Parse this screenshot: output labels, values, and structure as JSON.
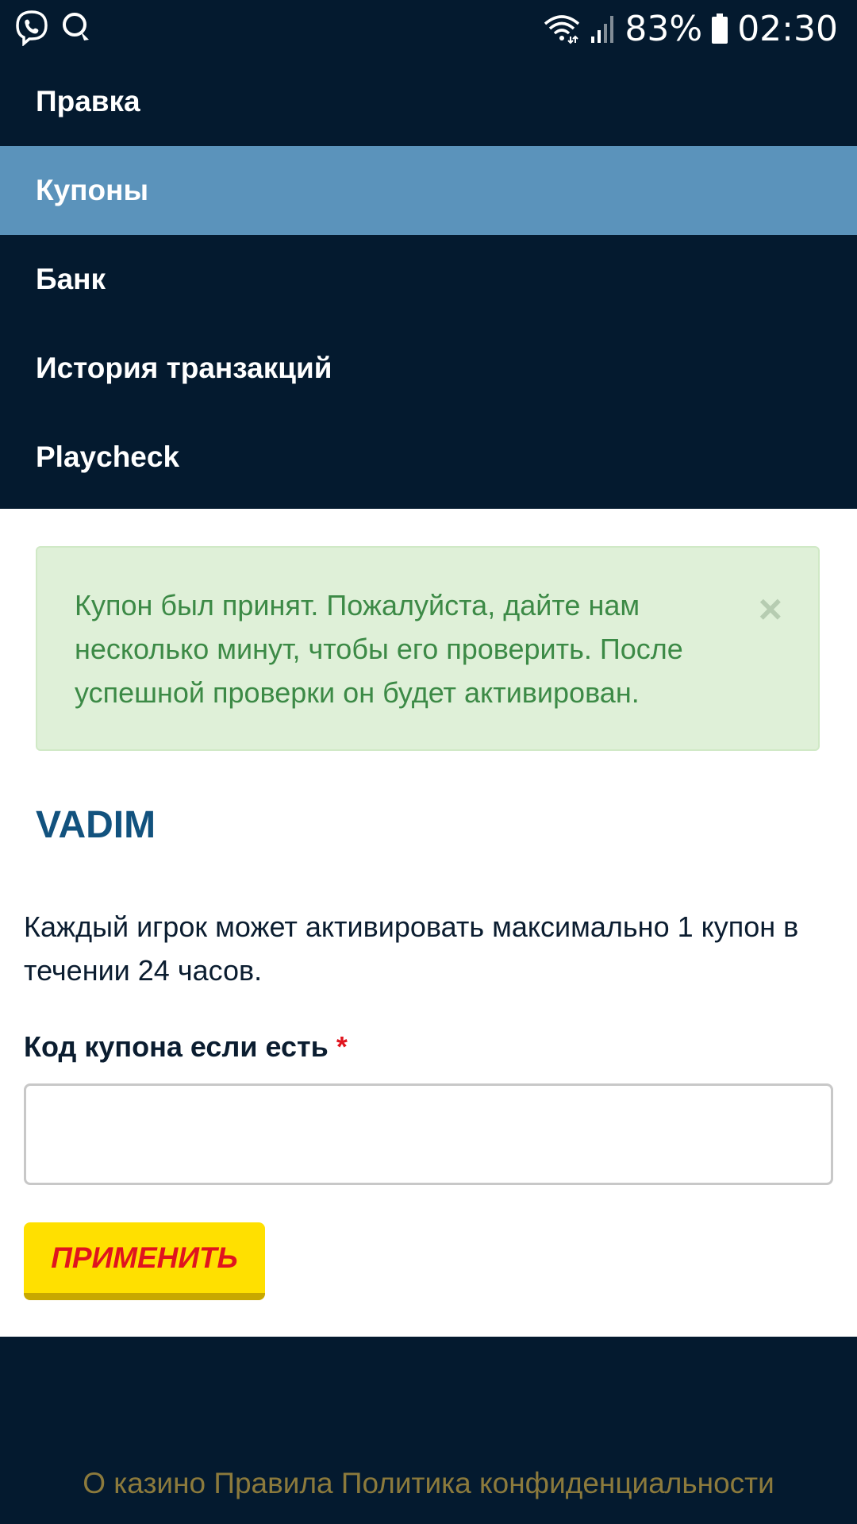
{
  "status_bar": {
    "left_icons": [
      "viber-icon",
      "chat-bubble-icon"
    ],
    "battery": "83%",
    "time": "02:30"
  },
  "menu": {
    "items": [
      {
        "label": "Правка",
        "active": false
      },
      {
        "label": "Купоны",
        "active": true
      },
      {
        "label": "Банк",
        "active": false
      },
      {
        "label": "История транзакций",
        "active": false
      },
      {
        "label": "Playcheck",
        "active": false
      }
    ]
  },
  "alert": {
    "message": "Купон был принят. Пожалуйста, дайте нам несколько минут, чтобы его проверить. После успешной проверки он будет активирован.",
    "close": "×"
  },
  "user": {
    "name": "VADIM"
  },
  "coupon": {
    "info": "Каждый игрок может активировать максимально 1 купон в течении 24 часов.",
    "label": "Код купона если есть",
    "required": "*",
    "value": "",
    "button": "ПРИМЕНИТЬ"
  },
  "footer": {
    "links": [
      "О казино",
      "Правила",
      "Политика конфиденциальности"
    ]
  },
  "colors": {
    "dark_navy": "#041a2f",
    "menu_active": "#5b93bb",
    "alert_bg": "#dff0d8",
    "alert_text": "#3c8a46",
    "username": "#12527e",
    "button_bg": "#ffe000",
    "button_text": "#e0141e",
    "footer_link": "#8c7a3c"
  }
}
